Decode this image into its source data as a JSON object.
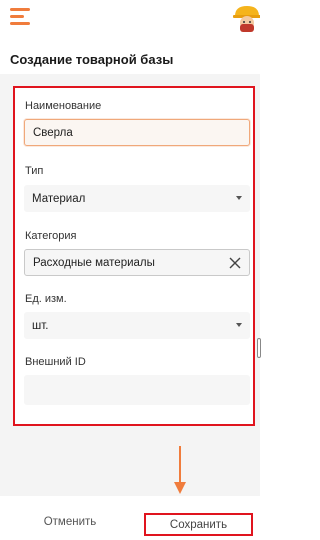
{
  "header": {
    "menu_icon": "hamburger-menu-icon",
    "avatar_icon": "worker-hardhat-avatar-icon"
  },
  "page": {
    "title": "Создание товарной базы"
  },
  "form": {
    "name": {
      "label": "Наименование",
      "value": "Сверла"
    },
    "type": {
      "label": "Тип",
      "value": "Материал"
    },
    "category": {
      "label": "Категория",
      "value": "Расходные материалы"
    },
    "unit": {
      "label": "Ед. изм.",
      "value": "шт."
    },
    "external_id": {
      "label": "Внешний ID",
      "value": ""
    }
  },
  "footer": {
    "cancel_label": "Отменить",
    "save_label": "Сохранить"
  },
  "colors": {
    "accent_orange": "#f07c3c",
    "highlight_red": "#e0141e"
  }
}
